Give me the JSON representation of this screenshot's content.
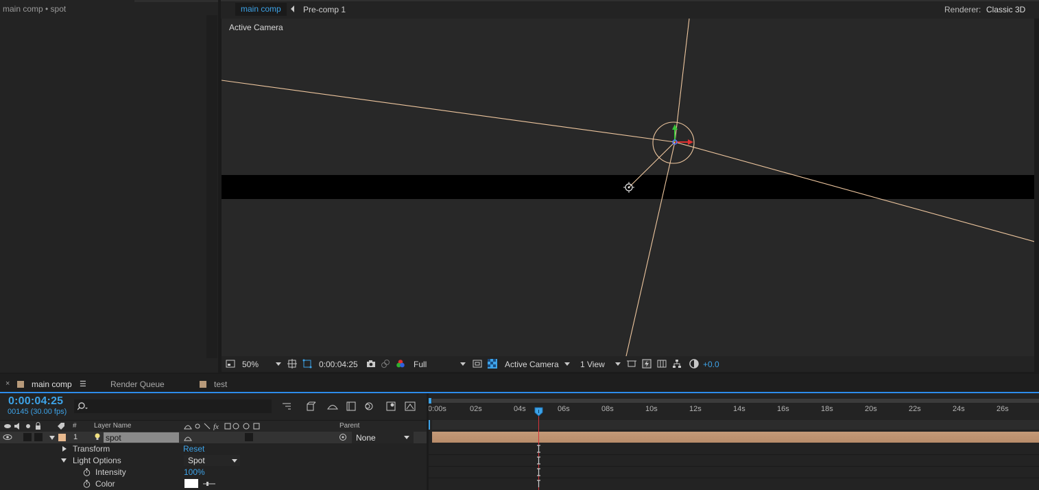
{
  "left_panel": {
    "title": "main comp • spot"
  },
  "comp_header": {
    "active_tab": "main comp",
    "breadcrumb": "Pre-comp 1",
    "renderer_label": "Renderer:",
    "renderer_value": "Classic 3D"
  },
  "viewer": {
    "view_label": "Active Camera"
  },
  "viewer_toolbar": {
    "zoom": "50%",
    "timecode": "0:00:04:25",
    "resolution": "Full",
    "camera": "Active Camera",
    "views": "1 View",
    "exposure": "+0.0"
  },
  "timeline_tabs": {
    "close": "×",
    "main": "main comp",
    "menu": "☰",
    "render_queue": "Render Queue",
    "test": "test",
    "main_color": "#b89a7a",
    "test_color": "#b89a7a"
  },
  "timeline": {
    "timecode": "0:00:04:25",
    "frames": "00145 (30.00 fps)",
    "columns": {
      "number": "#",
      "layer_name": "Layer Name",
      "parent": "Parent"
    },
    "layer": {
      "index": "1",
      "name": "spot",
      "parent": "None",
      "label_color": "#e8b98e"
    },
    "properties": [
      {
        "label": "Transform",
        "value": "Reset"
      },
      {
        "label": "Light Options",
        "value": "Spot"
      },
      {
        "label": "Intensity",
        "value": "100%"
      },
      {
        "label": "Color",
        "value": ""
      }
    ],
    "ruler_ticks": [
      "0:00s",
      "02s",
      "04s",
      "06s",
      "08s",
      "10s",
      "12s",
      "14s",
      "16s",
      "18s",
      "20s",
      "22s",
      "24s",
      "26s"
    ]
  }
}
